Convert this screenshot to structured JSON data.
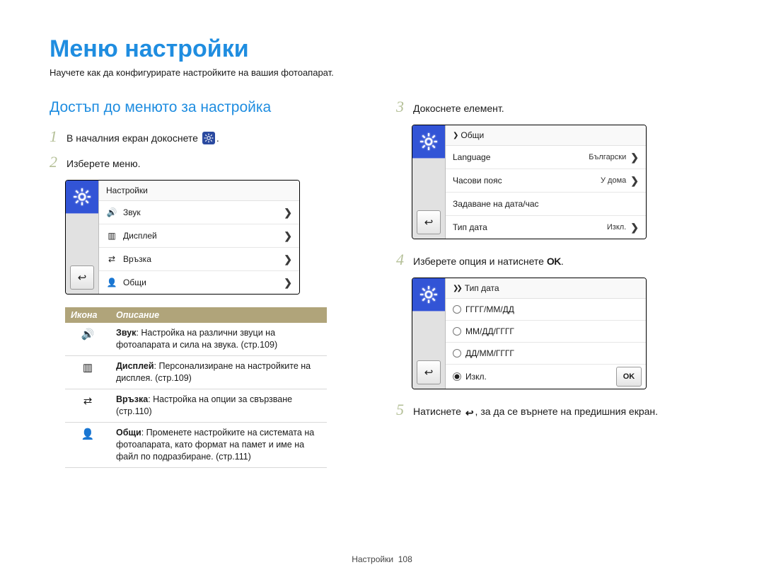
{
  "title": "Меню настройки",
  "intro": "Научете как да конфигурирате настройките на вашия фотоапарат.",
  "subtitle": "Достъп до менюто за настройка",
  "steps": {
    "s1_pre": "В началния екран докоснете ",
    "s1_post": ".",
    "s2": "Изберете меню.",
    "s3": "Докоснете елемент.",
    "s4_pre": "Изберете опция и натиснете ",
    "s4_ok": "OK",
    "s4_post": ".",
    "s5_pre": "Натиснете ",
    "s5_post": ", за да се върнете на предишния екран."
  },
  "device_a": {
    "header": "Настройки",
    "rows": [
      {
        "icon": "speaker",
        "label": "Звук"
      },
      {
        "icon": "display",
        "label": "Дисплей"
      },
      {
        "icon": "link",
        "label": "Връзка"
      },
      {
        "icon": "person",
        "label": "Общи"
      }
    ]
  },
  "device_b": {
    "header": "Общи",
    "rows": [
      {
        "label": "Language",
        "value": "Български"
      },
      {
        "label": "Часови пояс",
        "value": "У дома"
      },
      {
        "label": "Задаване на дата/час",
        "value": ""
      },
      {
        "label": "Тип дата",
        "value": "Изкл."
      }
    ]
  },
  "device_c": {
    "header": "Тип дата",
    "options": [
      "ГГГГ/ММ/ДД",
      "ММ/ДД/ГГГГ",
      "ДД/ММ/ГГГГ"
    ],
    "selected": "Изкл.",
    "ok_label": "OK"
  },
  "legend": {
    "col_icon": "Икона",
    "col_desc": "Описание",
    "rows": [
      {
        "icon": "speaker",
        "bold": "Звук",
        "text": ": Настройка на различни звуци на фотоапарата и сила на звука. (стр.109)"
      },
      {
        "icon": "display",
        "bold": "Дисплей",
        "text": ": Персонализиране на настройките на дисплея. (стр.109)"
      },
      {
        "icon": "link",
        "bold": "Връзка",
        "text": ": Настройка на опции за свързване (стр.110)"
      },
      {
        "icon": "person",
        "bold": "Общи",
        "text": ": Променете настройките на системата на фотоапарата, като формат на памет и име на файл по подразбиране. (стр.111)"
      }
    ]
  },
  "footer_label": "Настройки",
  "footer_page": "108"
}
